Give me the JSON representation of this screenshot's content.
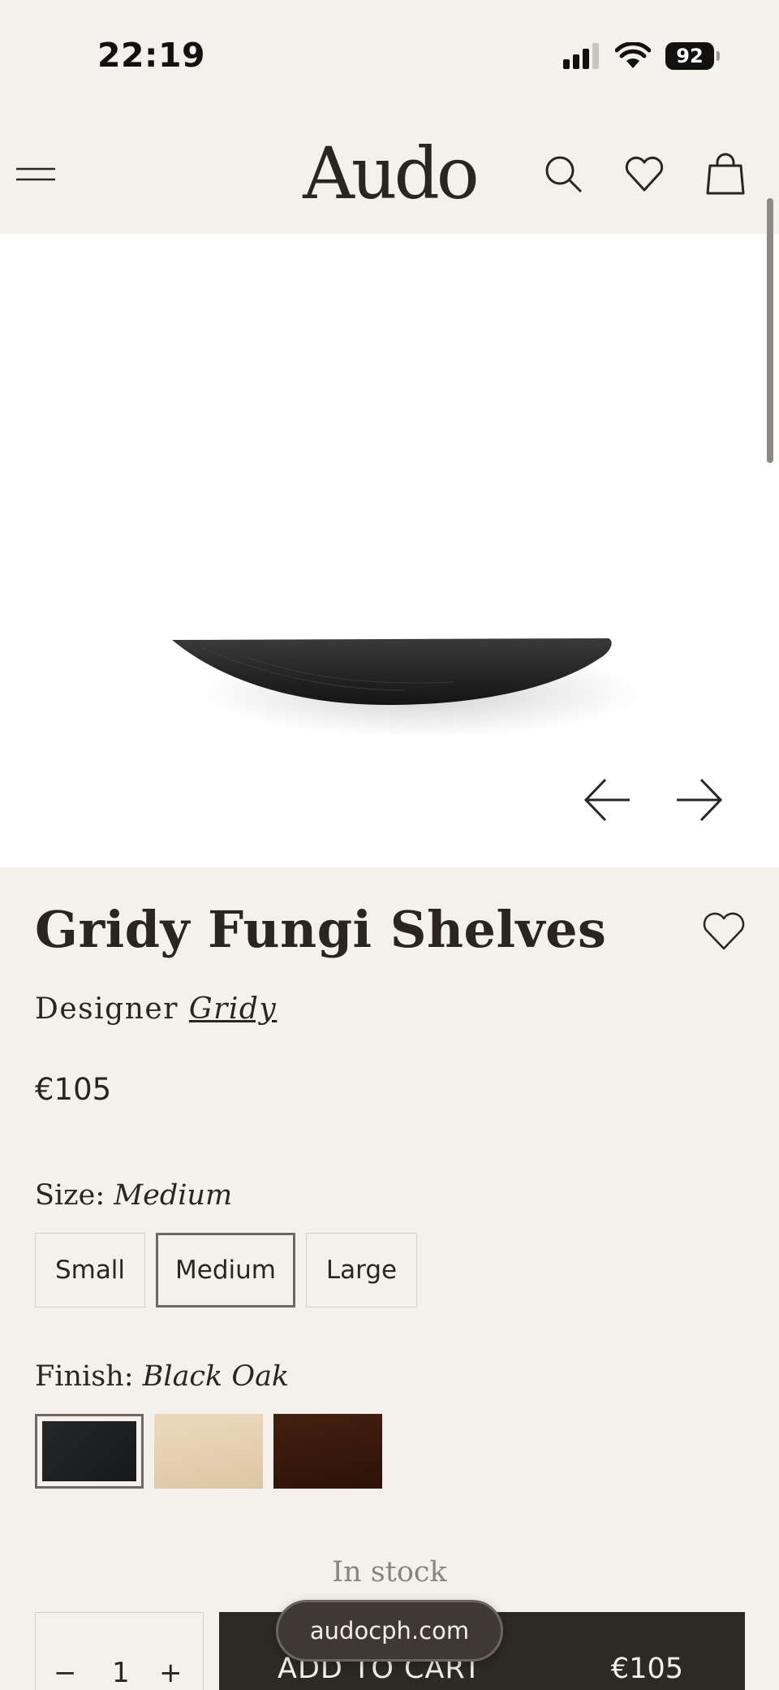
{
  "status_bar": {
    "time": "22:19",
    "battery": "92"
  },
  "header": {
    "logo": "Audo"
  },
  "product": {
    "title": "Gridy Fungi Shelves",
    "designer_label": "Designer",
    "designer_name": "Gridy",
    "price": "€105"
  },
  "size": {
    "label": "Size:",
    "selected": "Medium",
    "options": [
      "Small",
      "Medium",
      "Large"
    ]
  },
  "finish": {
    "label": "Finish:",
    "selected": "Black Oak",
    "swatch_colors": [
      "#1f2124",
      "#e6d2b4",
      "#3a1a10"
    ]
  },
  "stock_status": "In stock",
  "quantity": {
    "minus": "−",
    "value": "1",
    "plus": "+"
  },
  "cart": {
    "label": "ADD TO CART",
    "price": "€105"
  },
  "browser": {
    "url": "audocph.com"
  },
  "colors": {
    "background": "#f4f1ec",
    "dark": "#2d2923",
    "image_bg": "#ffffff"
  }
}
